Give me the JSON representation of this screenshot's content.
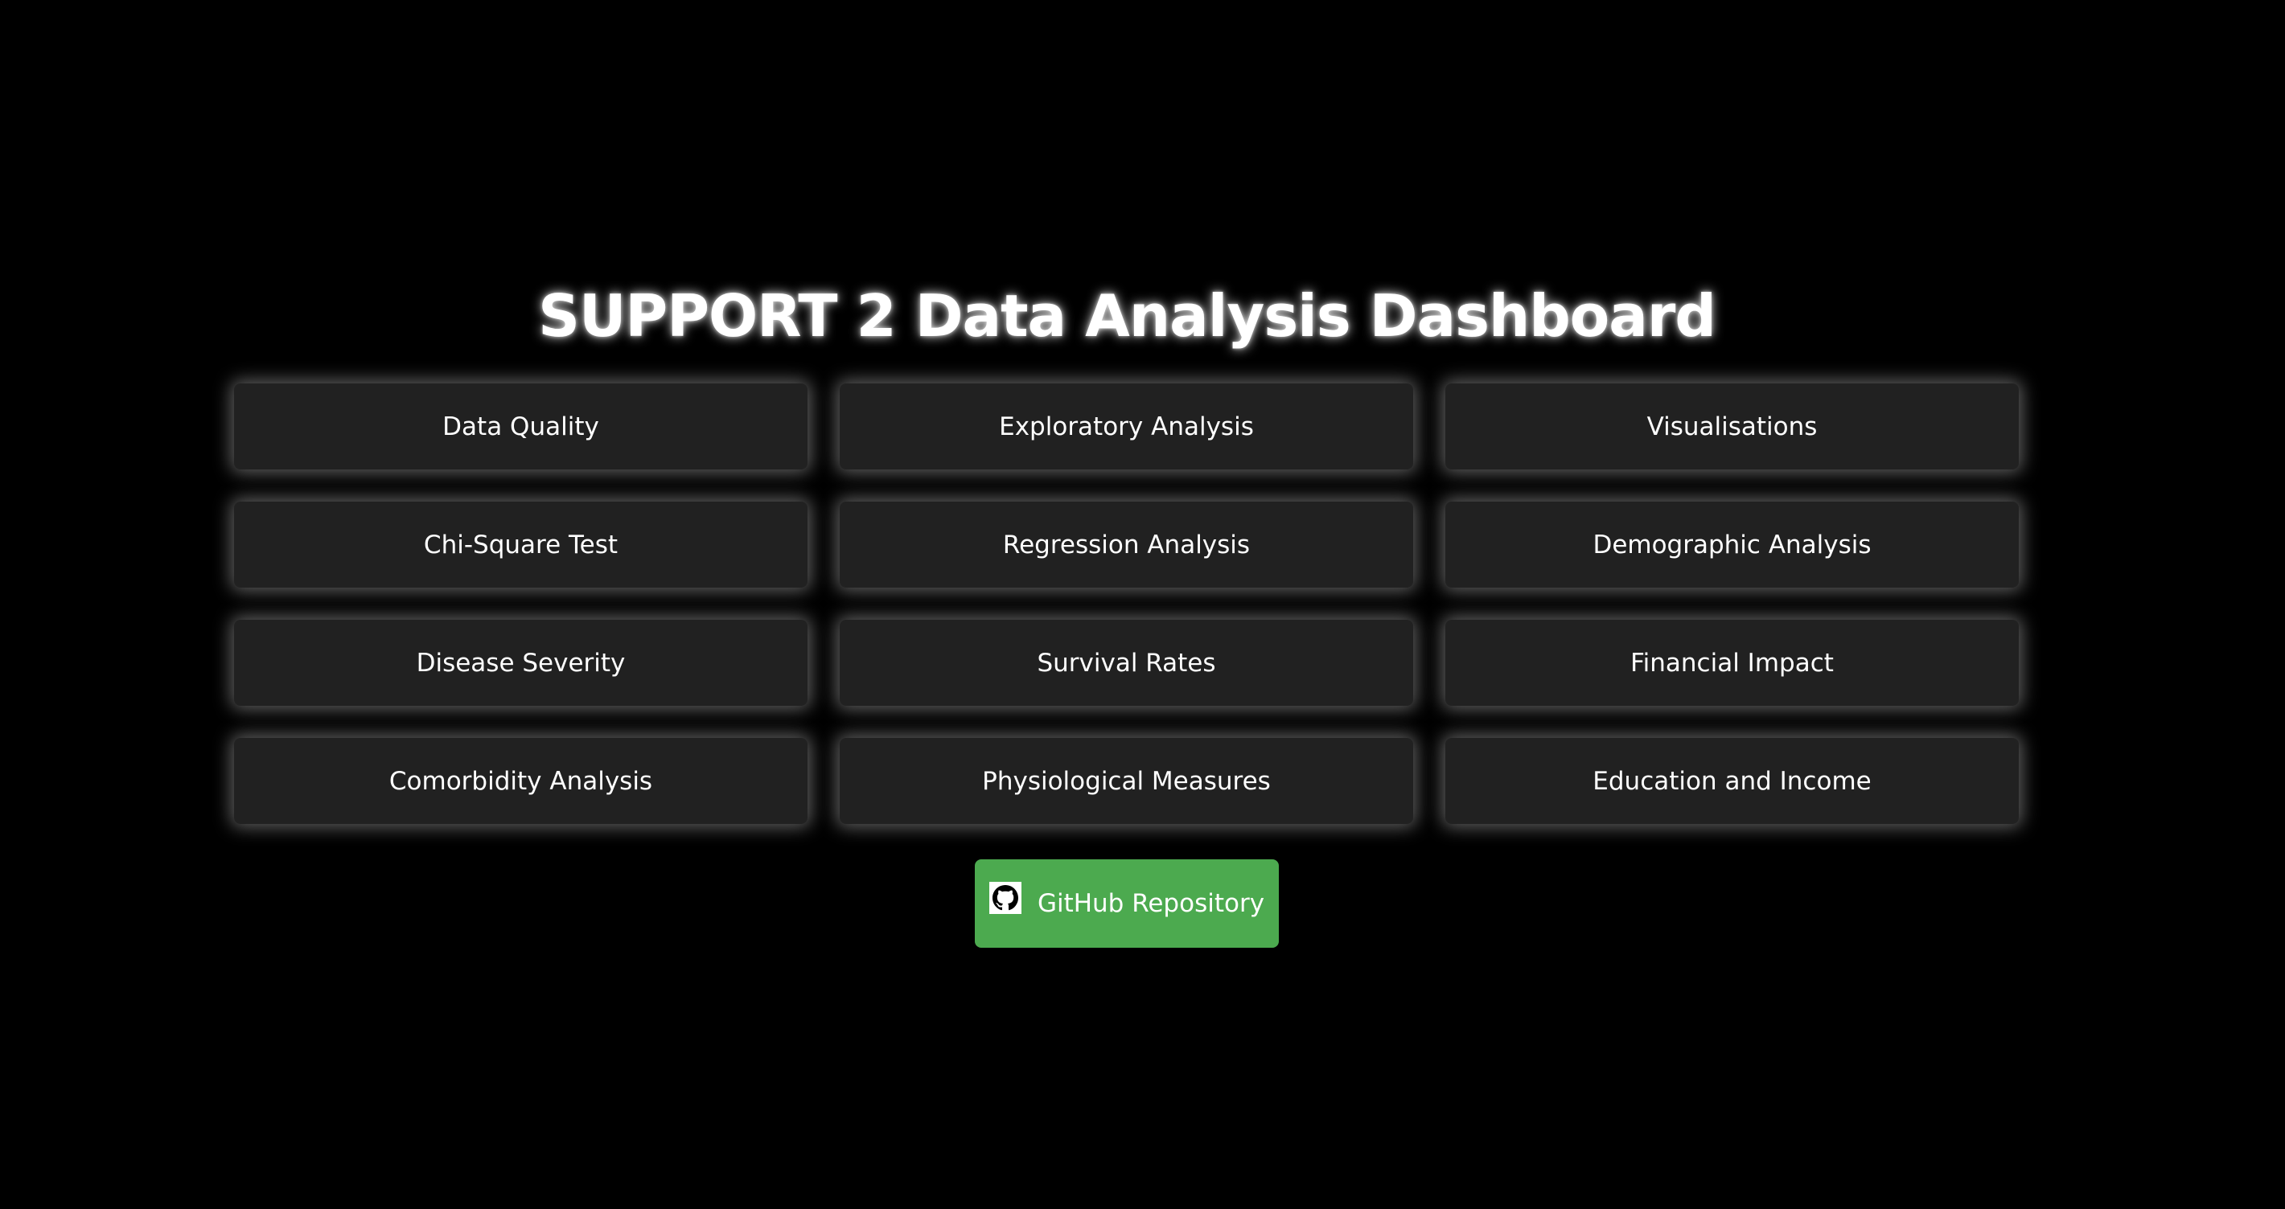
{
  "header": {
    "title": "SUPPORT 2 Data Analysis Dashboard"
  },
  "tiles": [
    {
      "label": "Data Quality"
    },
    {
      "label": "Exploratory Analysis"
    },
    {
      "label": "Visualisations"
    },
    {
      "label": "Chi-Square Test"
    },
    {
      "label": "Regression Analysis"
    },
    {
      "label": "Demographic Analysis"
    },
    {
      "label": "Disease Severity"
    },
    {
      "label": "Survival Rates"
    },
    {
      "label": "Financial Impact"
    },
    {
      "label": "Comorbidity Analysis"
    },
    {
      "label": "Physiological Measures"
    },
    {
      "label": "Education and Income"
    }
  ],
  "github": {
    "label": "GitHub Repository",
    "icon": "github-icon"
  },
  "colors": {
    "background": "#000000",
    "tile": "#212121",
    "accent": "#4caa4f",
    "text": "#ffffff"
  }
}
